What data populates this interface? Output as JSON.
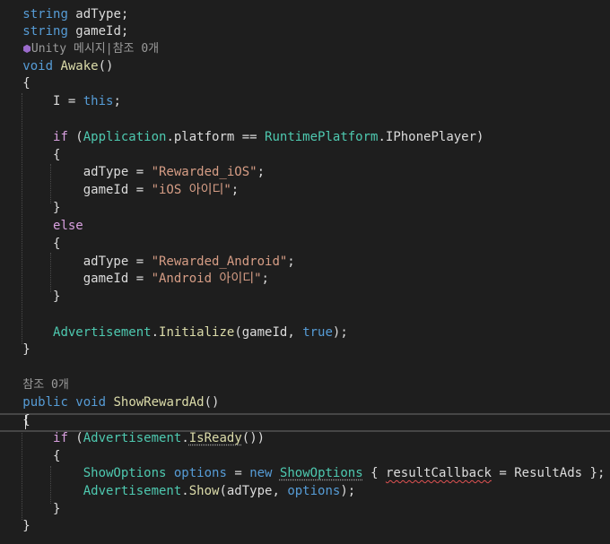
{
  "code": {
    "l1": {
      "kw": "string",
      "name": " adType;"
    },
    "l2": {
      "kw": "string",
      "name": " gameId;"
    },
    "l3": {
      "icon": "unity-icon",
      "text": "Unity 메시지|참조 0개"
    },
    "l4": {
      "kw": "void",
      "fn": "Awake",
      "rest": "()"
    },
    "l5": {
      "text": "{"
    },
    "l6": {
      "a": "I = ",
      "kw": "this",
      "b": ";"
    },
    "l8": {
      "ctl": "if",
      "a": " (",
      "ty": "Application",
      "b": ".platform == ",
      "ty2": "RuntimePlatform",
      "c": ".IPhonePlayer)"
    },
    "l9": {
      "text": "{"
    },
    "l10": {
      "a": "adType = ",
      "str": "\"Rewarded_iOS\"",
      "b": ";"
    },
    "l11": {
      "a": "gameId = ",
      "str": "\"iOS 아이디\"",
      "b": ";"
    },
    "l12": {
      "text": "}"
    },
    "l13": {
      "ctl": "else"
    },
    "l14": {
      "text": "{"
    },
    "l15": {
      "a": "adType = ",
      "str": "\"Rewarded_Android\"",
      "b": ";"
    },
    "l16": {
      "a": "gameId = ",
      "str": "\"Android 아이디\"",
      "b": ";"
    },
    "l17": {
      "text": "}"
    },
    "l19": {
      "ty": "Advertisement",
      "a": ".",
      "fn": "Initialize",
      "b": "(gameId, ",
      "kw": "true",
      "c": ");"
    },
    "l20": {
      "text": "}"
    },
    "l22": {
      "text": "참조 0개"
    },
    "l23": {
      "kw1": "public",
      "kw2": " void",
      "sp": " ",
      "fn": "ShowRewardAd",
      "rest": "()"
    },
    "l24": {
      "text": "{"
    },
    "l25": {
      "ctl": "if",
      "a": " (",
      "ty": "Advertisement",
      "b": ".",
      "fn": "IsReady",
      "c": "())"
    },
    "l26": {
      "text": "{"
    },
    "l27": {
      "ty": "ShowOptions",
      "a": " ",
      "var": "options",
      "b": " = ",
      "kw": "new",
      "c": " ",
      "ty2": "ShowOptions",
      "d": " { ",
      "sq": "resultCallback",
      "e": " = ResultAds };"
    },
    "l28": {
      "ty": "Advertisement",
      "a": ".",
      "fn": "Show",
      "b": "(adType, ",
      "var": "options",
      "c": ");"
    },
    "l29": {
      "text": "}"
    },
    "l30": {
      "text": "}"
    }
  }
}
